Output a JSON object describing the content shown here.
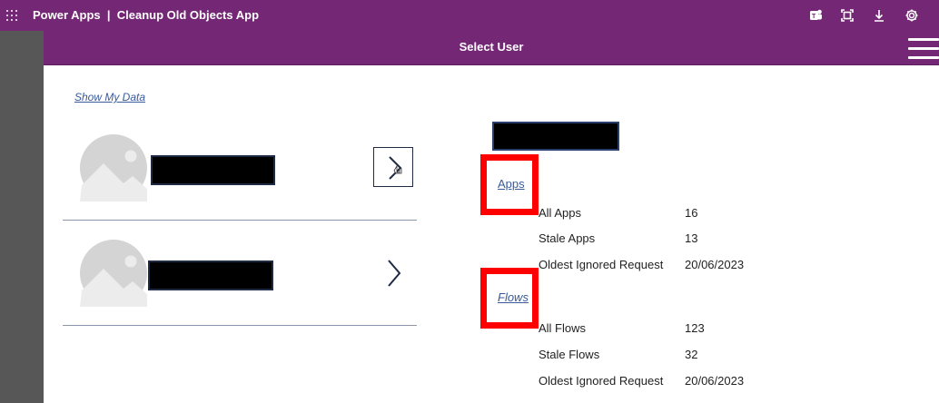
{
  "topbar": {
    "app_name": "Power Apps",
    "separator": "|",
    "app_title": "Cleanup Old Objects App",
    "icons": [
      "waffle-icon",
      "teams-icon",
      "fit-screen-icon",
      "download-icon",
      "settings-icon"
    ]
  },
  "header": {
    "title": "Select User"
  },
  "users": {
    "show_my_data": "Show My Data",
    "rows": [
      {
        "selected": true
      },
      {
        "selected": false
      }
    ]
  },
  "details": {
    "apps": {
      "label": "Apps",
      "rows": [
        {
          "label": "All Apps",
          "value": "16"
        },
        {
          "label": "Stale Apps",
          "value": "13"
        },
        {
          "label": "Oldest Ignored Request",
          "value": "20/06/2023"
        }
      ]
    },
    "flows": {
      "label": "Flows",
      "rows": [
        {
          "label": "All Flows",
          "value": "123"
        },
        {
          "label": "Stale Flows",
          "value": "32"
        },
        {
          "label": "Oldest Ignored Request",
          "value": "20/06/2023"
        }
      ]
    }
  },
  "colors": {
    "brand_purple": "#742774",
    "highlight_red": "#ff0000",
    "link_blue": "#3a5a9c"
  }
}
